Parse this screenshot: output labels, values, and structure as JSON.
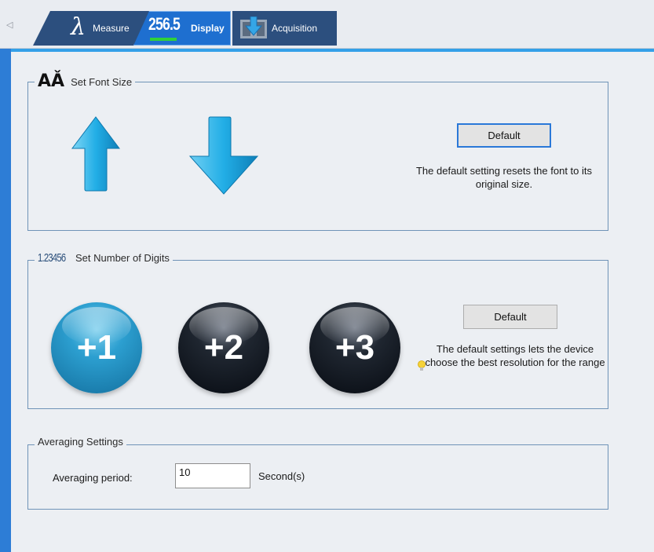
{
  "tabs": {
    "scroll_left_glyph": "◁",
    "measure_label": "Measure",
    "display_label": "Display",
    "display_value": "256.5",
    "acquisition_label": "Acquisition"
  },
  "font_size_group": {
    "legend": "Set Font Size",
    "icon_glyph": "AǍ",
    "default_label": "Default",
    "description": "The default setting resets the font to its original size."
  },
  "digits_group": {
    "legend": "Set Number of Digits",
    "icon_glyph": "1.23456",
    "plus1": "+1",
    "plus2": "+2",
    "plus3": "+3",
    "default_label": "Default",
    "description": "The default settings lets the device choose the best resolution for the range"
  },
  "averaging_group": {
    "legend": "Averaging Settings",
    "period_label": "Averaging period:",
    "period_value": "10",
    "unit": "Second(s)"
  },
  "colors": {
    "accent": "#34a0e8",
    "tab_active": "#1e6fd0",
    "tab_inactive": "#2c4f7e",
    "group_border": "#6f93b7"
  }
}
